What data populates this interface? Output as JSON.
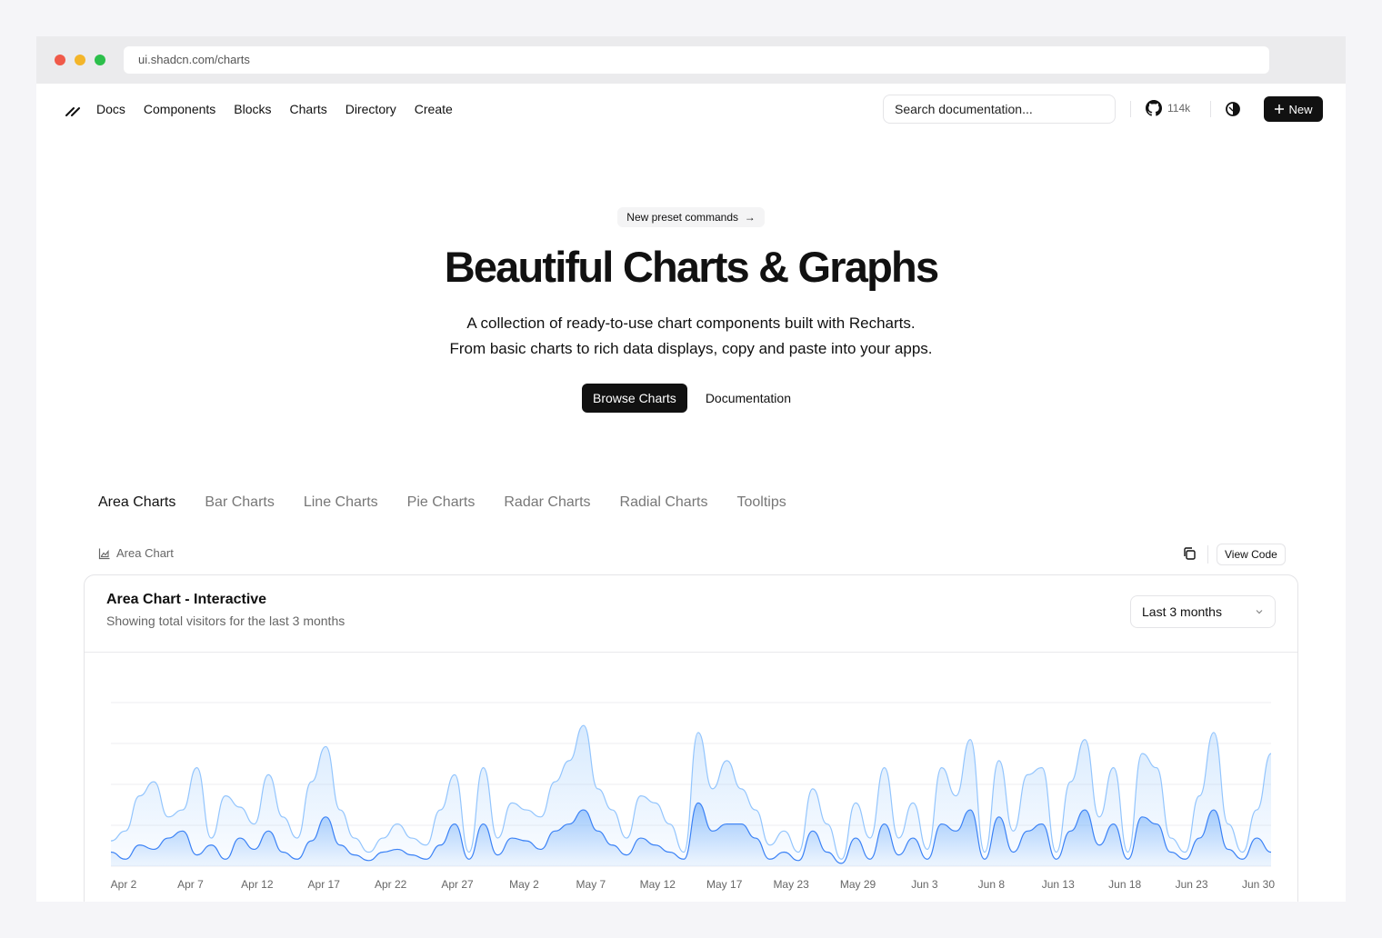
{
  "browser": {
    "url": "ui.shadcn.com/charts"
  },
  "nav": {
    "links": [
      "Docs",
      "Components",
      "Blocks",
      "Charts",
      "Directory",
      "Create"
    ],
    "search_placeholder": "Search documentation...",
    "github_stars": "114k",
    "new_label": "New"
  },
  "hero": {
    "badge": "New preset commands",
    "title": "Beautiful Charts & Graphs",
    "desc_line1": "A collection of ready-to-use chart components built with Recharts.",
    "desc_line2": "From basic charts to rich data displays, copy and paste into your apps.",
    "primary_cta": "Browse Charts",
    "secondary_cta": "Documentation"
  },
  "tabs": [
    "Area Charts",
    "Bar Charts",
    "Line Charts",
    "Pie Charts",
    "Radar Charts",
    "Radial Charts",
    "Tooltips"
  ],
  "active_tab": 0,
  "toolbar": {
    "label": "Area Chart",
    "view_code": "View Code"
  },
  "card": {
    "title": "Area Chart - Interactive",
    "description": "Showing total visitors for the last 3 months",
    "range_select": "Last 3 months"
  },
  "colors": {
    "desktop": "#60a5fa",
    "mobile": "#93c5fd",
    "dark": "#111111"
  },
  "chart_data": {
    "type": "area",
    "x_tick_labels": [
      "Apr 2",
      "Apr 7",
      "Apr 12",
      "Apr 17",
      "Apr 22",
      "Apr 27",
      "May 2",
      "May 7",
      "May 12",
      "May 17",
      "May 23",
      "May 29",
      "Jun 3",
      "Jun 8",
      "Jun 13",
      "Jun 18",
      "Jun 23",
      "Jun 30"
    ],
    "grid": "horizontal",
    "stacked": true,
    "series": [
      {
        "values": [
          0.1,
          0.05,
          0.15,
          0.12,
          0.2,
          0.25,
          0.08,
          0.15,
          0.05,
          0.2,
          0.12,
          0.25,
          0.1,
          0.05,
          0.18,
          0.35,
          0.15,
          0.08,
          0.04,
          0.1,
          0.12,
          0.08,
          0.05,
          0.15,
          0.3,
          0.05,
          0.3,
          0.08,
          0.2,
          0.18,
          0.12,
          0.25,
          0.3,
          0.4,
          0.25,
          0.15,
          0.08,
          0.2,
          0.15,
          0.1,
          0.05,
          0.45,
          0.25,
          0.3,
          0.3,
          0.2,
          0.05,
          0.1,
          0.04,
          0.25,
          0.1,
          0.02,
          0.2,
          0.05,
          0.3,
          0.08,
          0.2,
          0.05,
          0.3,
          0.25,
          0.4,
          0.05,
          0.35,
          0.1,
          0.25,
          0.3,
          0.05,
          0.25,
          0.4,
          0.15,
          0.3,
          0.05,
          0.35,
          0.3,
          0.1,
          0.05,
          0.2,
          0.4,
          0.12,
          0.05,
          0.2,
          0.1
        ]
      },
      {
        "values": [
          0.18,
          0.25,
          0.5,
          0.6,
          0.35,
          0.4,
          0.7,
          0.2,
          0.5,
          0.42,
          0.3,
          0.65,
          0.35,
          0.2,
          0.6,
          0.85,
          0.4,
          0.2,
          0.1,
          0.2,
          0.3,
          0.2,
          0.15,
          0.4,
          0.65,
          0.1,
          0.7,
          0.2,
          0.45,
          0.4,
          0.35,
          0.6,
          0.75,
          1.0,
          0.55,
          0.4,
          0.2,
          0.5,
          0.45,
          0.3,
          0.1,
          0.95,
          0.55,
          0.75,
          0.55,
          0.4,
          0.15,
          0.25,
          0.1,
          0.55,
          0.3,
          0.05,
          0.45,
          0.2,
          0.7,
          0.2,
          0.45,
          0.12,
          0.7,
          0.5,
          0.9,
          0.1,
          0.75,
          0.25,
          0.65,
          0.7,
          0.1,
          0.6,
          0.9,
          0.35,
          0.7,
          0.1,
          0.8,
          0.7,
          0.2,
          0.1,
          0.5,
          0.95,
          0.3,
          0.1,
          0.4,
          0.8
        ]
      }
    ]
  }
}
